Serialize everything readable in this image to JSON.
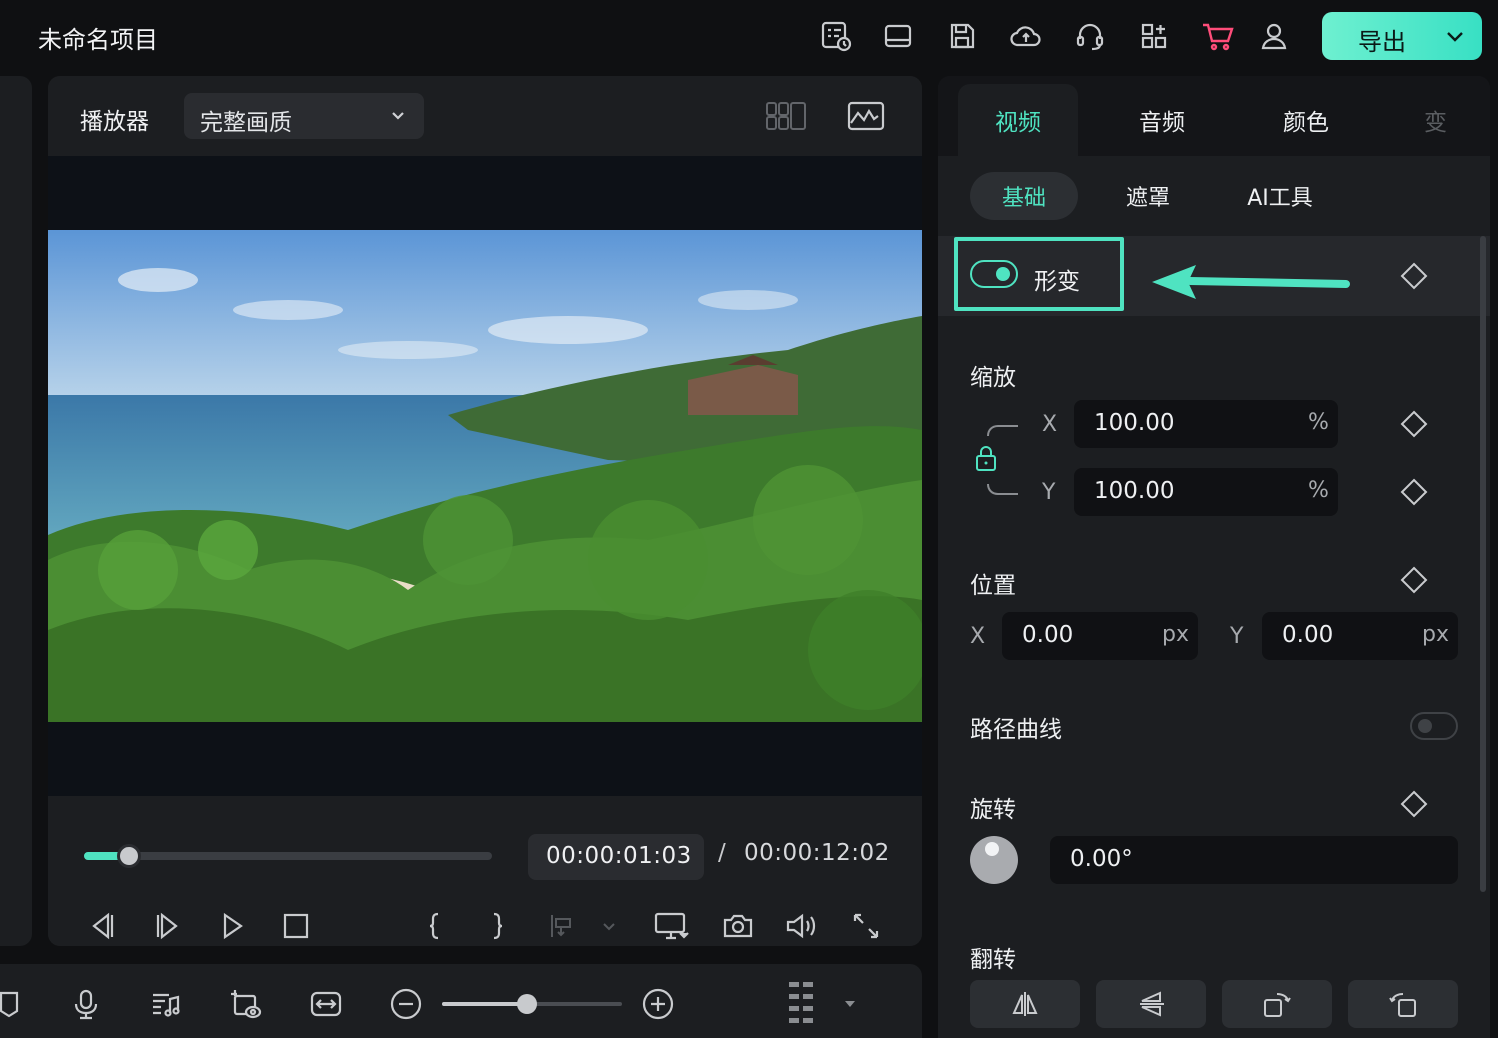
{
  "app": {
    "title": "未命名项目",
    "accent": "#4fe3c1",
    "cart_color": "#ff4d7a",
    "export_label": "导出"
  },
  "topbar_icons": [
    "task-list-icon",
    "layout-icon",
    "save-icon",
    "cloud-upload-icon",
    "headset-support-icon",
    "apps-grid-icon",
    "cart-icon",
    "user-icon"
  ],
  "player": {
    "label": "播放器",
    "quality": "完整画质",
    "current_time": "00:00:01:03",
    "separator": "/",
    "total_time": "00:00:12:02",
    "progress_fraction": 0.11
  },
  "properties": {
    "tabs": [
      "视频",
      "音频",
      "颜色",
      "变"
    ],
    "active_tab": "视频",
    "subtabs": [
      "基础",
      "遮罩",
      "AI工具"
    ],
    "active_subtab": "基础",
    "transform": {
      "label": "形变",
      "enabled": true
    },
    "scale": {
      "label": "缩放",
      "x_label": "X",
      "y_label": "Y",
      "x": "100.00",
      "y": "100.00",
      "unit": "%"
    },
    "position": {
      "label": "位置",
      "x_label": "X",
      "y_label": "Y",
      "x": "0.00",
      "y": "0.00",
      "unit": "px"
    },
    "path_curve": {
      "label": "路径曲线",
      "enabled": false
    },
    "rotation": {
      "label": "旋转",
      "value": "0.00°"
    },
    "flip": {
      "label": "翻转"
    }
  },
  "zoom": {
    "fraction": 0.47
  }
}
